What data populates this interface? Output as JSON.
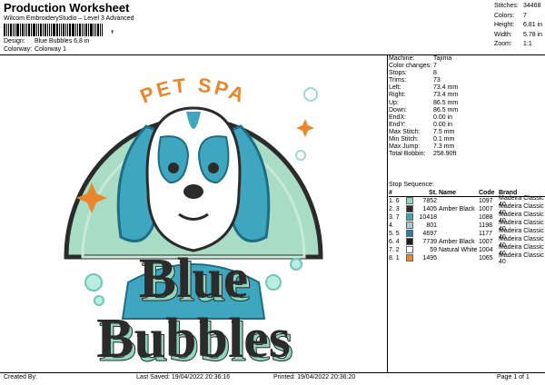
{
  "header": {
    "title": "Production Worksheet",
    "subtitle": "Wilcom EmbroideryStudio – Level 3 Advanced",
    "barcode_suffix": ","
  },
  "meta": {
    "design_label": "Design:",
    "design_value": "Blue Bubbles 6,8 in",
    "colorway_label": "Colorway:",
    "colorway_value": "Colorway 1"
  },
  "stats": [
    {
      "label": "Stitches:",
      "value": "34468"
    },
    {
      "label": "Colors:",
      "value": "7"
    },
    {
      "label": "Height:",
      "value": "6.81 in"
    },
    {
      "label": "Width:",
      "value": "5.78 in"
    },
    {
      "label": "Zoom:",
      "value": "1:1"
    }
  ],
  "machine_info": [
    {
      "label": "Machine:",
      "value": "Tajima"
    },
    {
      "label": "Color changes:",
      "value": "7"
    },
    {
      "label": "Stops:",
      "value": "8"
    },
    {
      "label": "Trims:",
      "value": "73"
    },
    {
      "label": "Left:",
      "value": "73.4 mm"
    },
    {
      "label": "Right:",
      "value": "73.4 mm"
    },
    {
      "label": "Up:",
      "value": "86.5 mm"
    },
    {
      "label": "Down:",
      "value": "86.5 mm"
    },
    {
      "label": "EndX:",
      "value": "0.00 in"
    },
    {
      "label": "EndY:",
      "value": "0.00 in"
    },
    {
      "label": "Max Stitch:",
      "value": "7.5 mm"
    },
    {
      "label": "Min Stitch:",
      "value": "0.1 mm"
    },
    {
      "label": "Max Jump:",
      "value": "7.3 mm"
    },
    {
      "label": "Total Bobbin:",
      "value": "258.90ft"
    }
  ],
  "stop_sequence": {
    "title": "Stop Sequence:",
    "headers": [
      "#",
      "St.",
      "Name",
      "Code",
      "Brand"
    ],
    "rows": [
      {
        "no": "1.",
        "n": "6",
        "color": "#8fd6be",
        "st": "7852",
        "name": "",
        "code": "1097",
        "brand": "Madeira Classic 40"
      },
      {
        "no": "2.",
        "n": "3",
        "color": "#2d2d2d",
        "st": "1405",
        "name": "Amber Black",
        "code": "1007",
        "brand": "Madeira Classic 40"
      },
      {
        "no": "3.",
        "n": "7",
        "color": "#43a4b5",
        "st": "10418",
        "name": "",
        "code": "1088",
        "brand": "Madeira Classic 40"
      },
      {
        "no": "4.",
        "n": "",
        "color": "#a9c8d8",
        "st": "801",
        "name": "",
        "code": "1198",
        "brand": "Madeira Classic 40"
      },
      {
        "no": "5.",
        "n": "5",
        "color": "#2a7fa6",
        "st": "4697",
        "name": "",
        "code": "1177",
        "brand": "Madeira Classic 40"
      },
      {
        "no": "6.",
        "n": "4",
        "color": "#1e1e1e",
        "st": "7739",
        "name": "Amber Black",
        "code": "1007",
        "brand": "Madeira Classic 40"
      },
      {
        "no": "7.",
        "n": "2",
        "color": "#ffffff",
        "st": "59",
        "name": "Natural White",
        "code": "1004",
        "brand": "Madeira Classic 40"
      },
      {
        "no": "8.",
        "n": "1",
        "color": "#e8872c",
        "st": "1495",
        "name": "",
        "code": "1065",
        "brand": "Madeira Classic 40"
      }
    ]
  },
  "design": {
    "arc_text": "PET SPA",
    "word1": "Blue",
    "word2": "Bubbles",
    "colors": {
      "mint": "#a9dcc4",
      "teal": "#3fa6bf",
      "dark": "#2b2b2b",
      "orange": "#e8872c",
      "white": "#ffffff"
    }
  },
  "footer": {
    "created_by": "Created By:",
    "last_saved": "Last Saved: 19/04/2022 20:36:16",
    "printed": "Printed: 19/04/2022 20:36:20",
    "page": "Page 1 of 1"
  }
}
